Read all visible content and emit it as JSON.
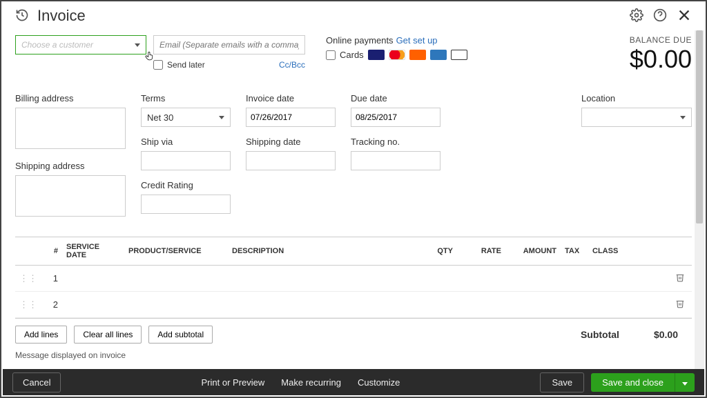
{
  "header": {
    "title": "Invoice"
  },
  "customer": {
    "placeholder": "Choose a customer"
  },
  "email": {
    "placeholder": "Email (Separate emails with a comma)",
    "send_later_label": "Send later",
    "ccbcc_label": "Cc/Bcc"
  },
  "payments": {
    "label": "Online payments",
    "link": "Get set up",
    "cards_label": "Cards"
  },
  "balance": {
    "label": "BALANCE DUE",
    "amount": "$0.00"
  },
  "fields": {
    "billing_address": "Billing address",
    "shipping_address": "Shipping address",
    "terms": "Terms",
    "terms_value": "Net 30",
    "invoice_date": "Invoice date",
    "invoice_date_value": "07/26/2017",
    "due_date": "Due date",
    "due_date_value": "08/25/2017",
    "location": "Location",
    "ship_via": "Ship via",
    "shipping_date": "Shipping date",
    "tracking_no": "Tracking no.",
    "credit_rating": "Credit Rating"
  },
  "table": {
    "headers": {
      "num": "#",
      "service_date": "SERVICE DATE",
      "product_service": "PRODUCT/SERVICE",
      "description": "DESCRIPTION",
      "qty": "QTY",
      "rate": "RATE",
      "amount": "AMOUNT",
      "tax": "TAX",
      "class": "CLASS"
    },
    "rows": [
      "1",
      "2"
    ]
  },
  "actions": {
    "add_lines": "Add lines",
    "clear_all": "Clear all lines",
    "add_subtotal": "Add subtotal"
  },
  "subtotal": {
    "label": "Subtotal",
    "value": "$0.00"
  },
  "message_label": "Message displayed on invoice",
  "footer": {
    "cancel": "Cancel",
    "print": "Print or Preview",
    "recurring": "Make recurring",
    "customize": "Customize",
    "save": "Save",
    "save_close": "Save and close"
  }
}
